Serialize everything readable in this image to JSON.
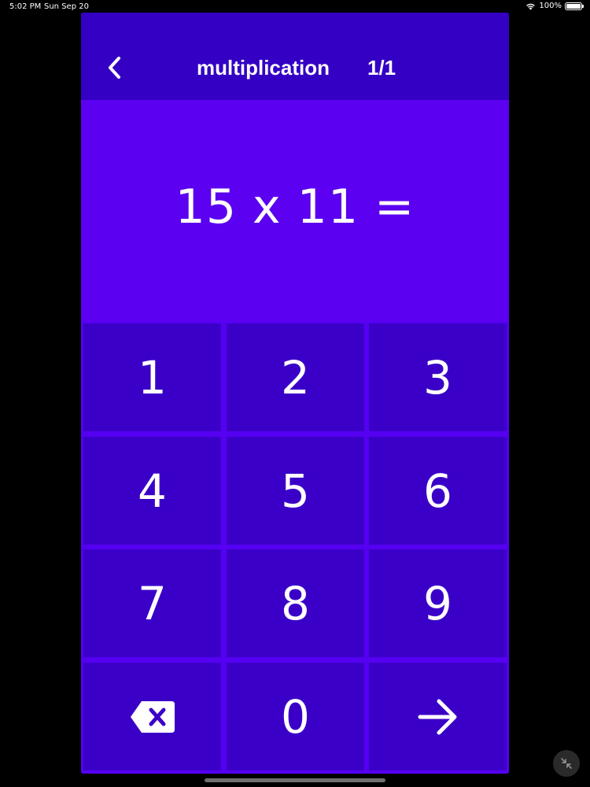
{
  "status_bar": {
    "time": "5:02 PM",
    "date": "Sun Sep 20",
    "battery": "100%"
  },
  "header": {
    "title": "multiplication",
    "progress": "1/1",
    "back_icon": "chevron-left-icon"
  },
  "question": {
    "text": "15 x 11 ="
  },
  "keypad": {
    "keys": [
      "1",
      "2",
      "3",
      "4",
      "5",
      "6",
      "7",
      "8",
      "9",
      "",
      "0",
      ""
    ],
    "backspace_icon": "backspace-icon",
    "submit_icon": "arrow-right-icon"
  },
  "colors": {
    "header_bg": "#3300c4",
    "question_bg": "#5b00f0",
    "key_bg": "#3b00c8",
    "grid_bg": "#5500f2",
    "text": "#ffffff"
  }
}
